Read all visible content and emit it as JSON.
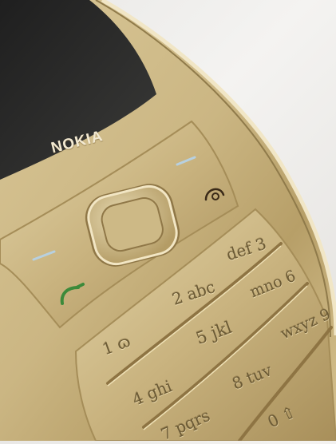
{
  "brand": "NOKIA",
  "keypad": {
    "k1": "1 ɷ",
    "k2": "2 abc",
    "k3": "def 3",
    "k4": "4 ghi",
    "k5": "5 jkl",
    "k6": "mno 6",
    "k7": "7 pqrs",
    "k8": "8 tuv",
    "k9": "wxyz 9",
    "k0": "0 ⇧"
  },
  "colors": {
    "gold": "#cdb987",
    "gold_dark": "#9c8654",
    "screen": "#262626",
    "call_key": "#3c8a3a",
    "end_key": "#3a2a18"
  },
  "icons": [
    "call-icon",
    "end-call-icon",
    "navigation-key-icon"
  ]
}
